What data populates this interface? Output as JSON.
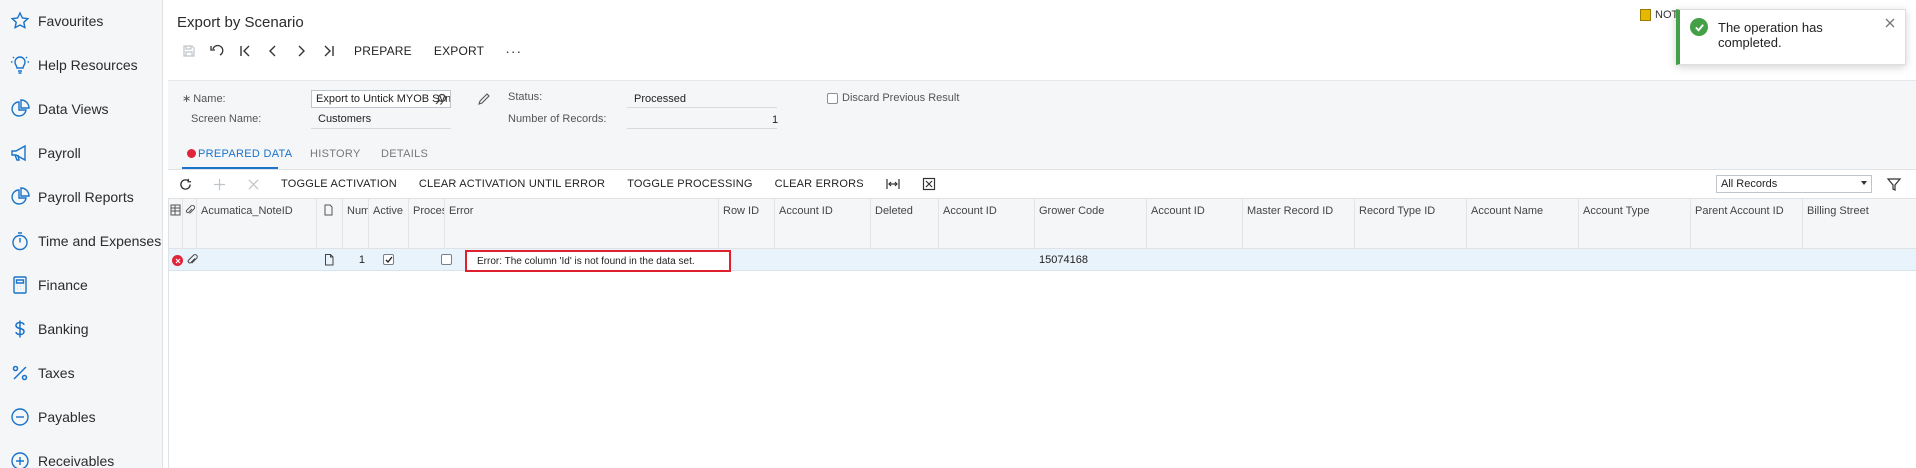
{
  "sidebar": {
    "items": [
      {
        "label": "Favourites",
        "icon": "star-icon"
      },
      {
        "label": "Help Resources",
        "icon": "lightbulb-icon"
      },
      {
        "label": "Data Views",
        "icon": "pie-chart-icon"
      },
      {
        "label": "Payroll",
        "icon": "megaphone-icon"
      },
      {
        "label": "Payroll Reports",
        "icon": "pie-chart-icon"
      },
      {
        "label": "Time and Expenses",
        "icon": "stopwatch-icon"
      },
      {
        "label": "Finance",
        "icon": "calculator-icon"
      },
      {
        "label": "Banking",
        "icon": "dollar-icon"
      },
      {
        "label": "Taxes",
        "icon": "percent-icon"
      },
      {
        "label": "Payables",
        "icon": "minus-circle-icon"
      },
      {
        "label": "Receivables",
        "icon": "plus-circle-icon"
      }
    ]
  },
  "header": {
    "title": "Export by Scenario",
    "prepare_label": "PREPARE",
    "export_label": "EXPORT",
    "more_label": "···"
  },
  "notes": {
    "label": "NOTI"
  },
  "toast": {
    "message": "The operation has completed."
  },
  "form": {
    "name_label": "Name:",
    "name_value": "Export to Untick MYOB Sync",
    "screen_name_label": "Screen Name:",
    "screen_name_value": "Customers",
    "status_label": "Status:",
    "status_value": "Processed",
    "records_label": "Number of Records:",
    "records_value": "1",
    "discard_label": "Discard Previous Result"
  },
  "tabs": {
    "prepared": "PREPARED DATA",
    "history": "HISTORY",
    "details": "DETAILS"
  },
  "grid_toolbar": {
    "toggle_activation": "TOGGLE ACTIVATION",
    "clear_activation": "CLEAR ACTIVATION UNTIL ERROR",
    "toggle_processing": "TOGGLE PROCESSING",
    "clear_errors": "CLEAR ERRORS",
    "filter_value": "All Records"
  },
  "grid": {
    "columns": {
      "note_id": "Acumatica_NoteID",
      "num": "Num",
      "active": "Active",
      "processed": "Proces",
      "error": "Error",
      "row_id": "Row ID",
      "account_id_1": "Account ID",
      "deleted": "Deleted",
      "account_id_2": "Account ID",
      "grower_code": "Grower Code",
      "account_id_3": "Account ID",
      "master_record_id": "Master Record ID",
      "record_type_id": "Record Type ID",
      "account_name": "Account Name",
      "account_type": "Account Type",
      "parent_account_id": "Parent Account ID",
      "billing_street": "Billing Street"
    },
    "row": {
      "num": "1",
      "error": "Error: The column 'Id' is not found in the data set.",
      "grower_code": "15074168"
    }
  }
}
